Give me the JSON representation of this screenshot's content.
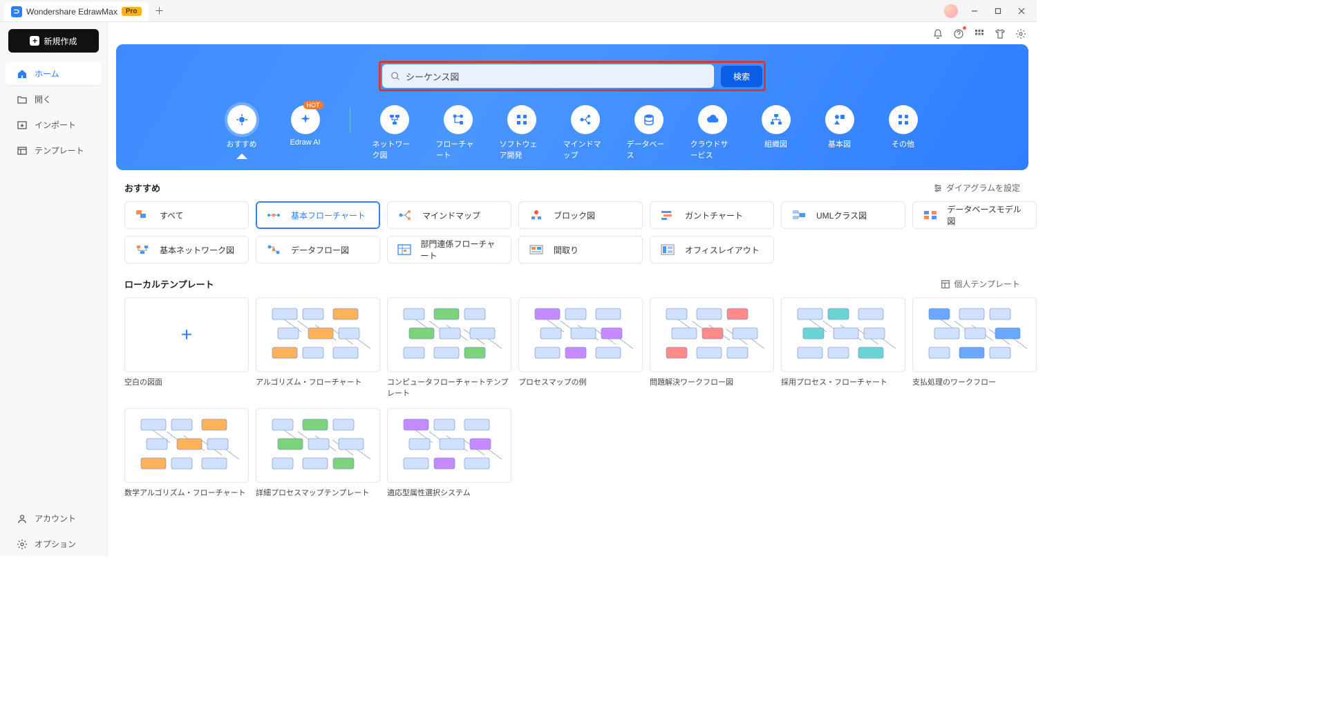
{
  "window": {
    "app_name": "Wondershare EdrawMax",
    "pro_badge": "Pro"
  },
  "sidebar": {
    "new_button": "新規作成",
    "items": [
      {
        "icon": "home",
        "label": "ホーム",
        "active": true
      },
      {
        "icon": "folder",
        "label": "開く",
        "active": false
      },
      {
        "icon": "import",
        "label": "インポート",
        "active": false
      },
      {
        "icon": "template",
        "label": "テンプレート",
        "active": false
      }
    ],
    "footer": [
      {
        "icon": "user",
        "label": "アカウント"
      },
      {
        "icon": "gear",
        "label": "オプション"
      }
    ]
  },
  "banner": {
    "search_value": "シーケンス図",
    "search_placeholder": "",
    "search_button": "検索",
    "categories": [
      {
        "label": "おすすめ",
        "badge": "",
        "active": true
      },
      {
        "label": "Edraw AI",
        "badge": "HOT",
        "active": false
      },
      {
        "label": "ネットワーク図",
        "badge": "",
        "active": false
      },
      {
        "label": "フローチャート",
        "badge": "",
        "active": false
      },
      {
        "label": "ソフトウェア開発",
        "badge": "",
        "active": false
      },
      {
        "label": "マインドマップ",
        "badge": "",
        "active": false
      },
      {
        "label": "データベース",
        "badge": "",
        "active": false
      },
      {
        "label": "クラウドサービス",
        "badge": "",
        "active": false
      },
      {
        "label": "組織図",
        "badge": "",
        "active": false
      },
      {
        "label": "基本図",
        "badge": "",
        "active": false
      },
      {
        "label": "その他",
        "badge": "",
        "active": false
      }
    ]
  },
  "recommend": {
    "title": "おすすめ",
    "settings_link": "ダイアグラムを設定",
    "chips": [
      {
        "label": "すべて",
        "active": false
      },
      {
        "label": "基本フローチャート",
        "active": true
      },
      {
        "label": "マインドマップ",
        "active": false
      },
      {
        "label": "ブロック図",
        "active": false
      },
      {
        "label": "ガントチャート",
        "active": false
      },
      {
        "label": "UMLクラス図",
        "active": false
      },
      {
        "label": "データベースモデル図",
        "active": false
      },
      {
        "label": "基本ネットワーク図",
        "active": false
      },
      {
        "label": "データフロー図",
        "active": false
      },
      {
        "label": "部門連係フローチャート",
        "active": false
      },
      {
        "label": "間取り",
        "active": false
      },
      {
        "label": "オフィスレイアウト",
        "active": false
      }
    ]
  },
  "local": {
    "title": "ローカルテンプレート",
    "personal_link": "個人テンプレート",
    "templates": [
      {
        "label": "空白の図面",
        "blank": true
      },
      {
        "label": "アルゴリズム・フローチャート"
      },
      {
        "label": "コンピュータフローチャートテンプレート"
      },
      {
        "label": "プロセスマップの例"
      },
      {
        "label": "問題解決ワークフロー図"
      },
      {
        "label": "採用プロセス・フローチャート"
      },
      {
        "label": "支払処理のワークフロー"
      },
      {
        "label": "数学アルゴリズム・フローチャート"
      },
      {
        "label": "詳細プロセスマップテンプレート"
      },
      {
        "label": "適応型属性選択システム"
      }
    ]
  }
}
